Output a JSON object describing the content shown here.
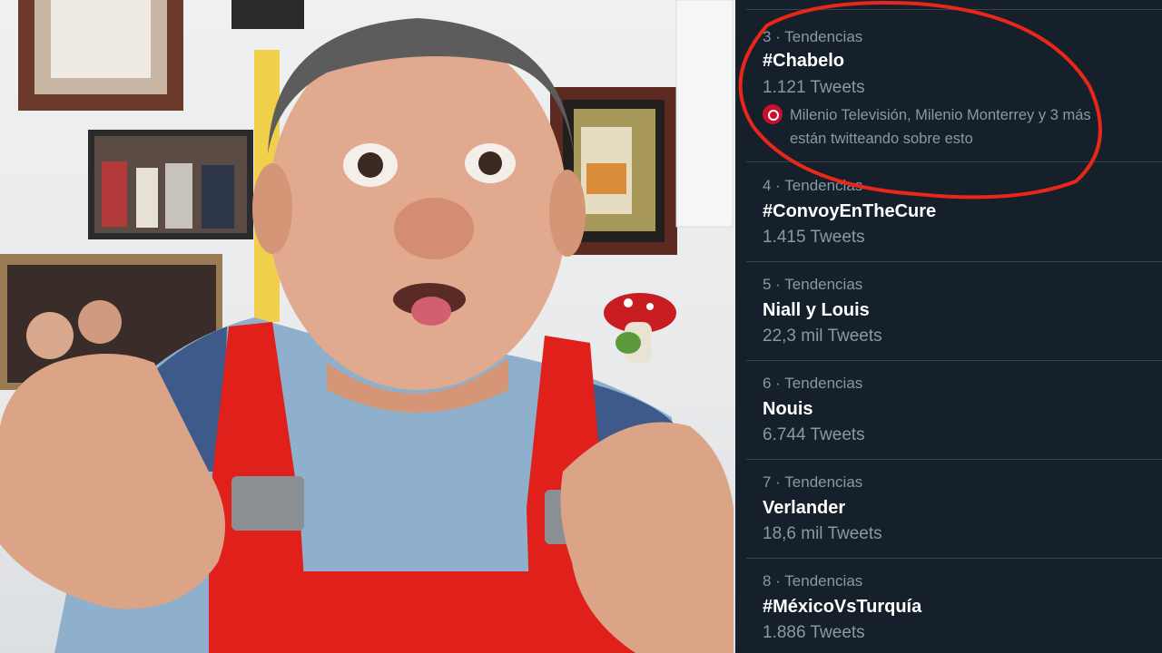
{
  "trends": [
    {
      "rank": "3",
      "category": "Tendencias",
      "name": "#Chabelo",
      "count": "1.121 Tweets",
      "context_line1": "Milenio Televisión, Milenio Monterrey y 3 más",
      "context_line2": "están twitteando sobre esto"
    },
    {
      "rank": "4",
      "category": "Tendencias",
      "name": "#ConvoyEnTheCure",
      "count": "1.415 Tweets"
    },
    {
      "rank": "5",
      "category": "Tendencias",
      "name": "Niall y Louis",
      "count": "22,3 mil Tweets"
    },
    {
      "rank": "6",
      "category": "Tendencias",
      "name": "Nouis",
      "count": "6.744 Tweets"
    },
    {
      "rank": "7",
      "category": "Tendencias",
      "name": "Verlander",
      "count": "18,6 mil Tweets"
    },
    {
      "rank": "8",
      "category": "Tendencias",
      "name": "#MéxicoVsTurquía",
      "count": "1.886 Tweets"
    }
  ],
  "labels": {
    "separator": " · "
  },
  "colors": {
    "panel_bg": "#15202b",
    "divider": "#38444d",
    "secondary_text": "#8899a6",
    "primary_text": "#ffffff",
    "highlight_ellipse": "#e8261a",
    "overalls_red": "#e0201b",
    "shirt_blue": "#8fb0cc"
  },
  "icons": {
    "context_avatar": "milenio-logo-icon"
  }
}
